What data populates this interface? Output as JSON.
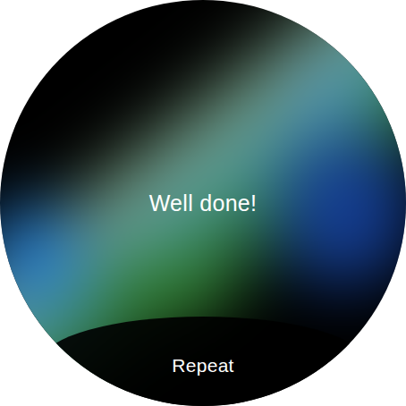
{
  "message": "Well done!",
  "buttons": [
    {
      "label": "Repeat"
    }
  ]
}
